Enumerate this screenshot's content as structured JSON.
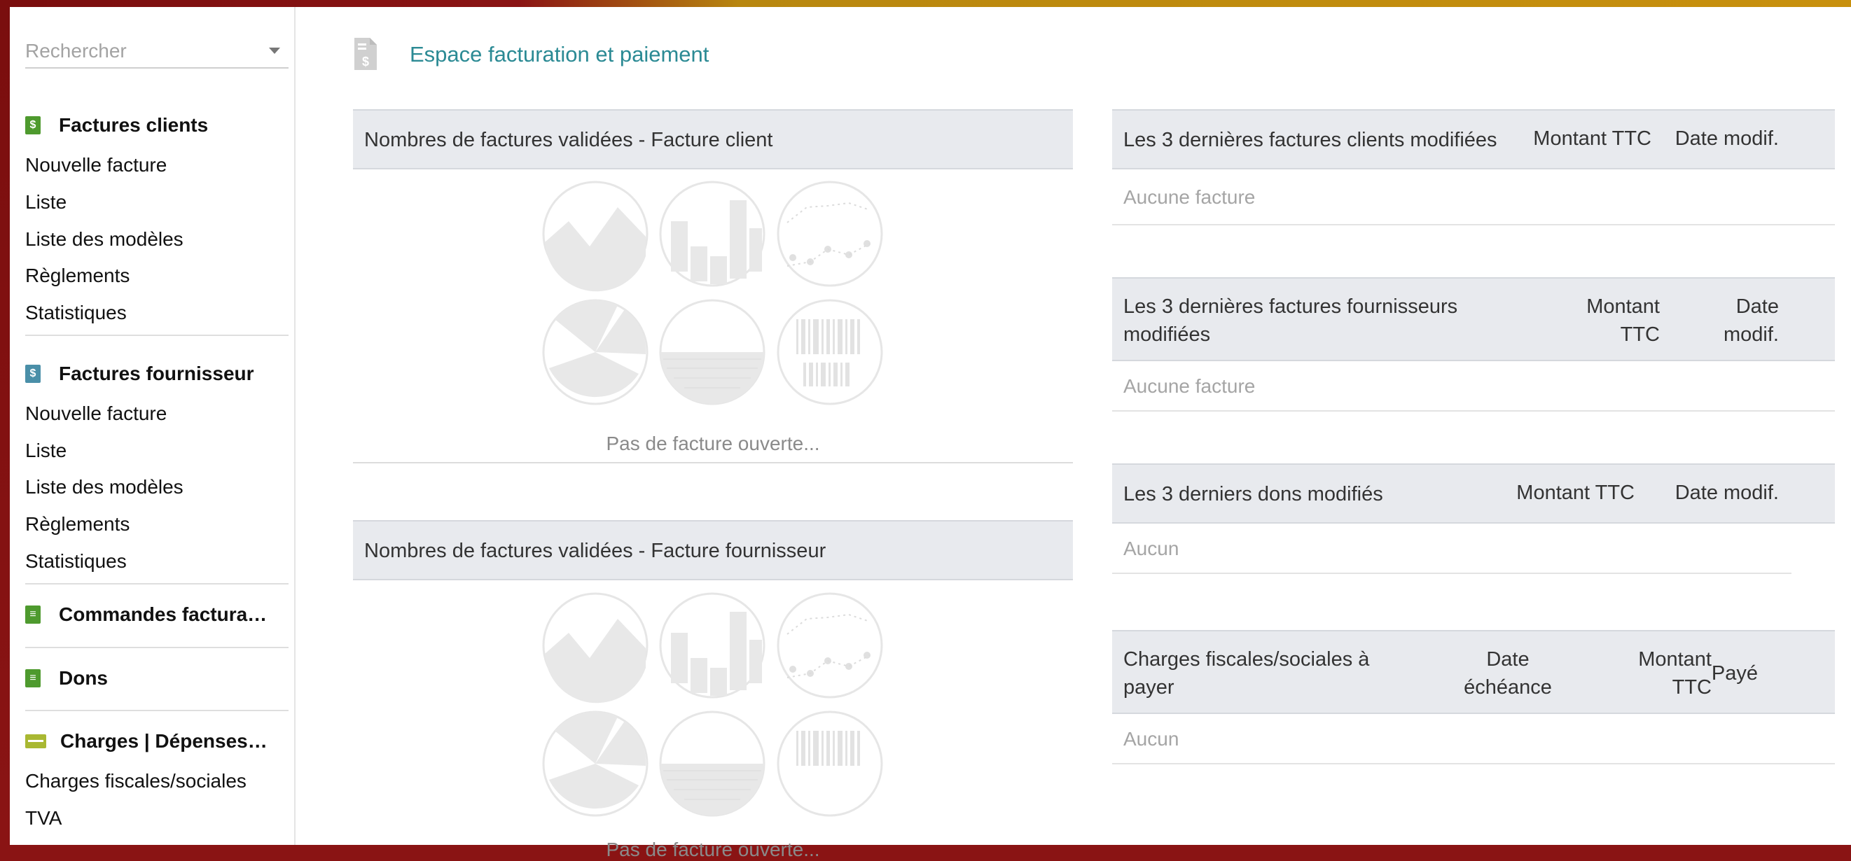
{
  "search": {
    "placeholder": "Rechercher"
  },
  "menu": {
    "factures_clients": {
      "title": "Factures clients",
      "items": [
        "Nouvelle facture",
        "Liste",
        "Liste des modèles",
        "Règlements",
        "Statistiques"
      ]
    },
    "factures_fournisseur": {
      "title": "Factures fournisseur",
      "items": [
        "Nouvelle facture",
        "Liste",
        "Liste des modèles",
        "Règlements",
        "Statistiques"
      ]
    },
    "commandes": {
      "title": "Commandes factura…"
    },
    "dons": {
      "title": "Dons"
    },
    "charges": {
      "title": "Charges | Dépenses…",
      "items": [
        "Charges fiscales/sociales",
        "TVA"
      ]
    }
  },
  "page": {
    "title": "Espace facturation et paiement"
  },
  "stats_client": {
    "title": "Nombres de factures validées - Facture client",
    "empty": "Pas de facture ouverte..."
  },
  "stats_fournisseur": {
    "title": "Nombres de factures validées - Facture fournisseur",
    "empty": "Pas de facture ouverte..."
  },
  "last_clients": {
    "title": "Les 3 dernières factures clients modifiées",
    "col_amount": "Montant TTC",
    "col_date": "Date modif.",
    "empty": "Aucune facture"
  },
  "last_suppliers": {
    "title_line1": "Les 3 dernières factures fournisseurs",
    "title_line2": "modifiées",
    "col_amount_line1": "Montant",
    "col_amount_line2": "TTC",
    "col_date_line1": "Date",
    "col_date_line2": "modif.",
    "empty": "Aucune facture"
  },
  "last_dons": {
    "title": "Les 3 derniers dons modifiés",
    "col_amount": "Montant TTC",
    "col_date": "Date modif.",
    "empty": "Aucun"
  },
  "charges_table": {
    "title_line1": "Charges fiscales/sociales à",
    "title_line2": "payer",
    "col_due_line1": "Date",
    "col_due_line2": "échéance",
    "col_amount_line1": "Montant",
    "col_amount_line2": "TTC",
    "col_paid": "Payé",
    "empty": "Aucun"
  },
  "colors": {
    "accent": "#2b8a94",
    "header_bg": "#e8eaee",
    "brand_bar": "#8a1414"
  },
  "icons": [
    "search-caret-icon",
    "invoice-icon",
    "card-icon",
    "chart-placeholder-icon"
  ]
}
